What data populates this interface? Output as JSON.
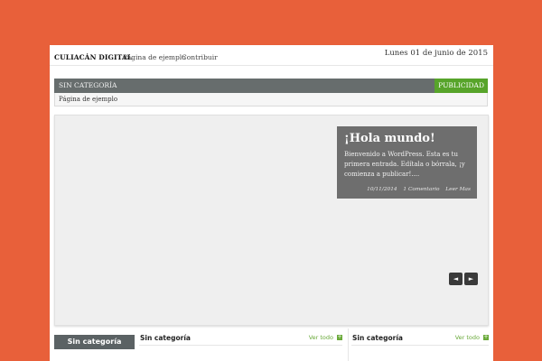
{
  "header": {
    "brand": "CULIACÁN DIGITAL",
    "nav": [
      "Página de ejemplo",
      "Contribuir"
    ],
    "date": "Lunes 01 de junio de 2015"
  },
  "category_bar": {
    "label": "SIN CATEGORÍA",
    "ad_button": "PUBLICIDAD"
  },
  "sub_nav": {
    "link": "Página de ejemplo"
  },
  "slider": {
    "title": "¡Hola mundo!",
    "excerpt": "Bienvenido a WordPress. Esta es tu primera entrada. Edítala o bórrala, ¡y comienza a publicar!....",
    "date": "10/11/2014",
    "comments": "1 Comentario",
    "read_more": "Leer Mas",
    "prev_symbol": "◄",
    "next_symbol": "►"
  },
  "bottom": {
    "tab_label": "Sin categoría",
    "columns": [
      {
        "title": "Sin categoría",
        "more": "Ver todo"
      },
      {
        "title": "Sin categoría",
        "more": "Ver todo"
      }
    ]
  },
  "colors": {
    "background": "#e8603a",
    "category_bar": "#676d6d",
    "ad_button": "#57a42a",
    "caption": "#6e6e6e",
    "accent_green": "#6aaa3a"
  }
}
